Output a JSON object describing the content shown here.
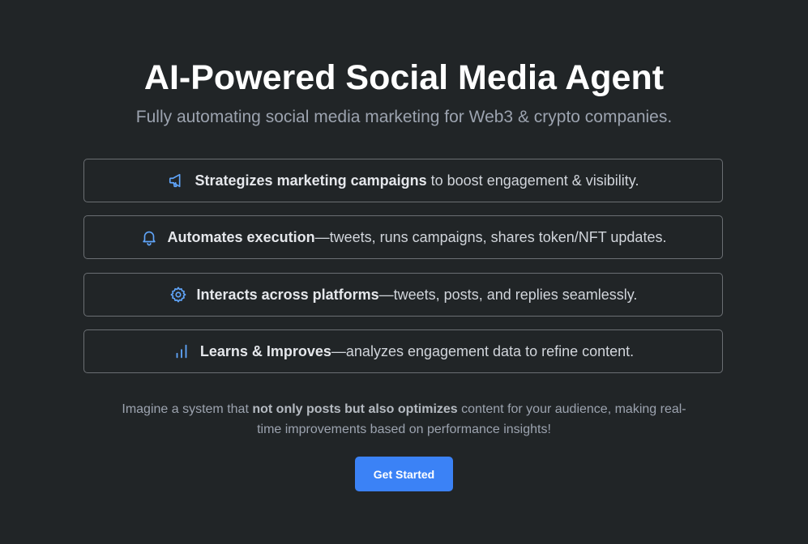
{
  "hero": {
    "title": "AI-Powered Social Media Agent",
    "subtitle": "Fully automating social media marketing for Web3 & crypto companies."
  },
  "features": [
    {
      "icon": "megaphone-icon",
      "bold": "Strategizes marketing campaigns",
      "text": " to boost engagement & visibility."
    },
    {
      "icon": "bell-icon",
      "bold": "Automates execution",
      "text": "—tweets, runs campaigns, shares token/NFT updates."
    },
    {
      "icon": "gear-icon",
      "bold": "Interacts across platforms",
      "text": "—tweets, posts, and replies seamlessly."
    },
    {
      "icon": "bar-chart-icon",
      "bold": "Learns & Improves",
      "text": "—analyzes engagement data to refine content."
    }
  ],
  "description": {
    "before": "Imagine a system that ",
    "bold": "not only posts but also optimizes",
    "after": " content for your audience, making real-time improvements based on performance insights!"
  },
  "cta": {
    "label": "Get Started"
  },
  "colors": {
    "background": "#212527",
    "accent": "#3b82f6",
    "icon": "#60a5fa"
  }
}
